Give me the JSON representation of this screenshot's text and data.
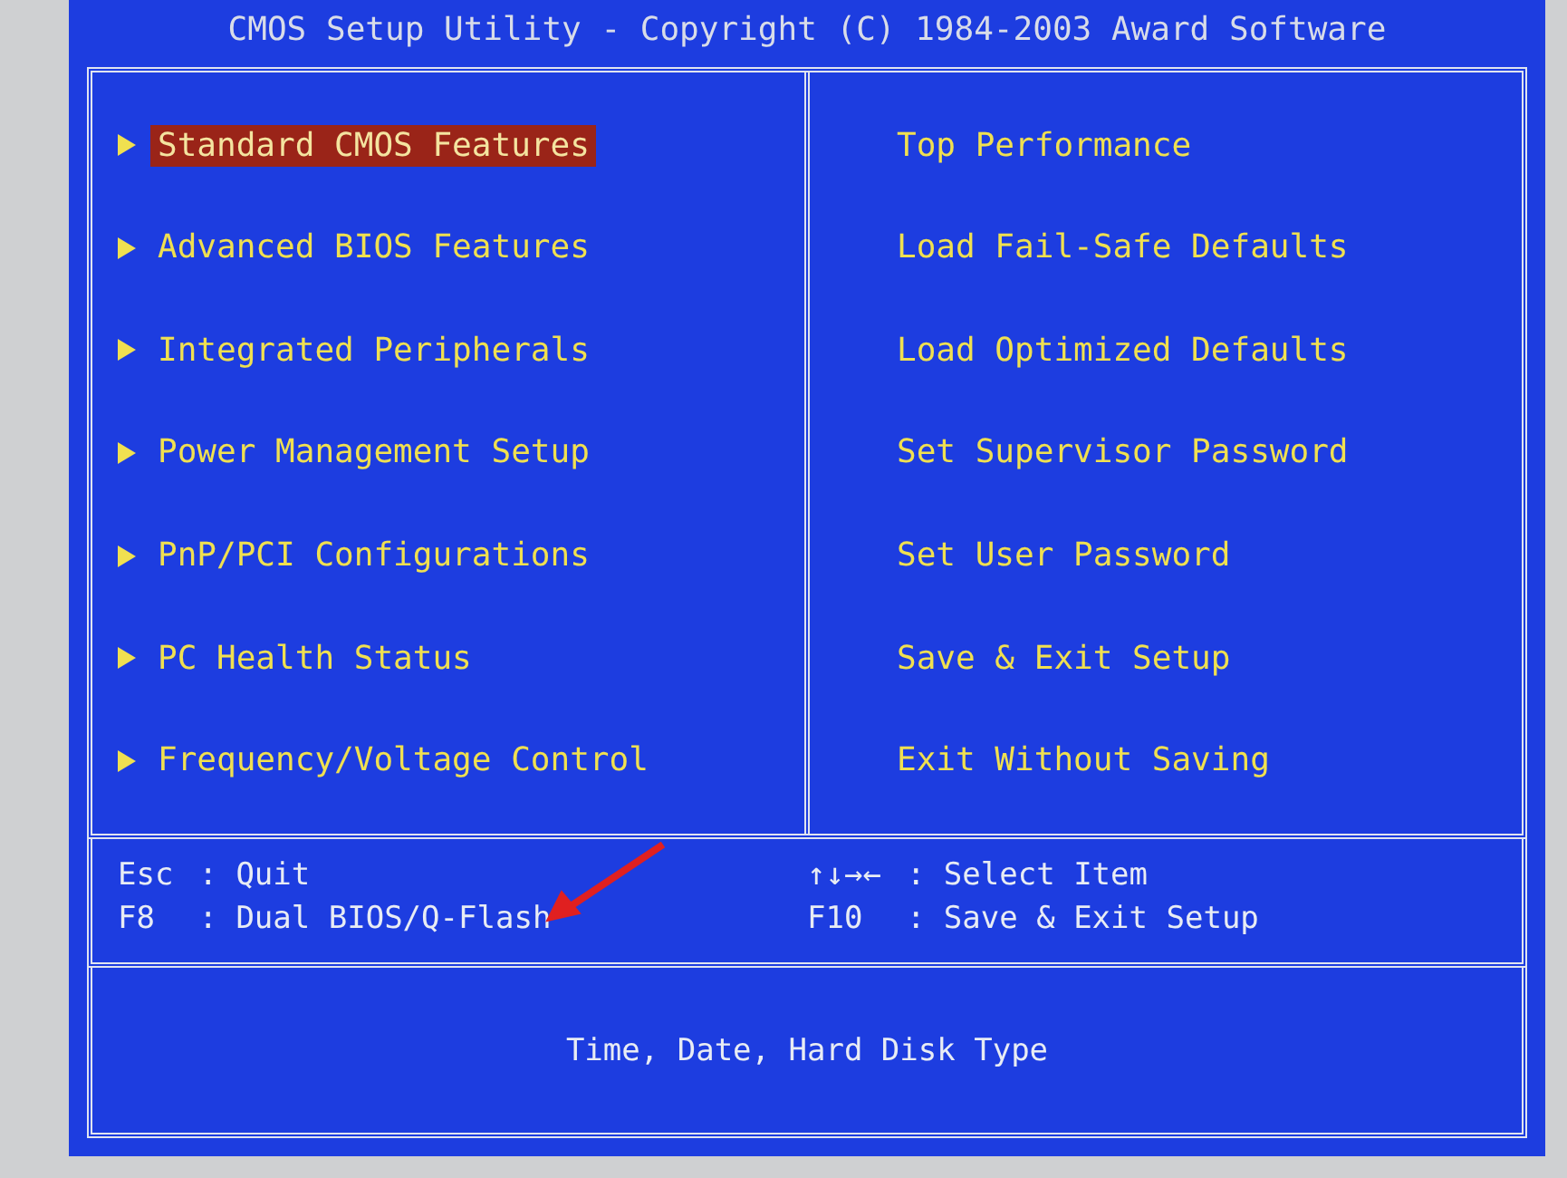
{
  "window": {
    "title": "CMOS Setup Utility - Copyright (C) 1984-2003 Award Software"
  },
  "menu_left": [
    {
      "label": "Standard CMOS Features",
      "selected": true
    },
    {
      "label": "Advanced BIOS Features",
      "selected": false
    },
    {
      "label": "Integrated Peripherals",
      "selected": false
    },
    {
      "label": "Power Management Setup",
      "selected": false
    },
    {
      "label": "PnP/PCI Configurations",
      "selected": false
    },
    {
      "label": "PC Health Status",
      "selected": false
    },
    {
      "label": "Frequency/Voltage Control",
      "selected": false
    }
  ],
  "menu_right": [
    {
      "label": "Top Performance",
      "selected": false
    },
    {
      "label": "Load Fail-Safe Defaults",
      "selected": false
    },
    {
      "label": "Load Optimized Defaults",
      "selected": false
    },
    {
      "label": "Set Supervisor Password",
      "selected": false
    },
    {
      "label": "Set User Password",
      "selected": false
    },
    {
      "label": "Save & Exit Setup",
      "selected": false
    },
    {
      "label": "Exit Without Saving",
      "selected": false
    }
  ],
  "help_left": [
    {
      "key": "Esc",
      "action": ": Quit"
    },
    {
      "key": "F8",
      "action": ": Dual BIOS/Q-Flash"
    }
  ],
  "help_right": [
    {
      "key": "↑↓→←",
      "action": ": Select Item"
    },
    {
      "key": "F10",
      "action": ": Save & Exit Setup"
    }
  ],
  "status_bar": "Time, Date, Hard Disk Type"
}
